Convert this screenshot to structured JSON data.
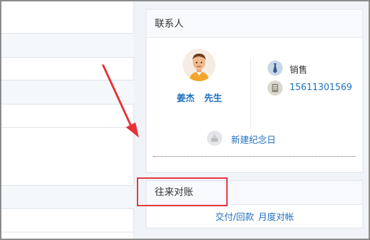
{
  "contact_card": {
    "title": "联系人",
    "person": {
      "surname": "姜杰",
      "salutation": "先生"
    },
    "role": "销售",
    "phone": "15611301569",
    "new_anniversary": "新建纪念日"
  },
  "reconciliation_card": {
    "title": "往来对账",
    "links": [
      "交付/回款",
      "月度对帐"
    ]
  },
  "colors": {
    "link": "#1e70c2",
    "annotation": "#e8323a",
    "panel_bg": "#f0f3f7"
  },
  "icons": [
    "avatar",
    "tie-icon",
    "phone-icon",
    "anniversary-icon"
  ]
}
